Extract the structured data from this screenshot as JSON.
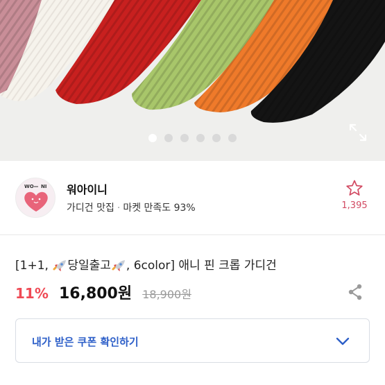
{
  "carousel": {
    "slide_count": 6,
    "active_index": 0,
    "swatch_colors": [
      "#c98e98",
      "#f5f2ec",
      "#c8201f",
      "#a8c66a",
      "#ef7a2a",
      "#141414"
    ],
    "expand_icon": "expand-icon"
  },
  "seller": {
    "avatar_text_left": "WO",
    "avatar_text_right": "NI",
    "name": "워아이니",
    "tagline": "가디건 맛집",
    "separator": "·",
    "satisfaction": "마켓 만족도 93%",
    "likes": "1,395"
  },
  "product": {
    "title_prefix": "[1+1,",
    "title_badge": "당일출고",
    "title_suffix": ", 6color] 애니 핀 크롭 가디건",
    "discount": "11%",
    "price": "16,800원",
    "original_price": "18,900원"
  },
  "coupon": {
    "label": "내가 받은 쿠폰 확인하기"
  },
  "colors": {
    "discount": "#ef4a55",
    "coupon_text": "#2d5fc8",
    "like": "#d24a62"
  }
}
